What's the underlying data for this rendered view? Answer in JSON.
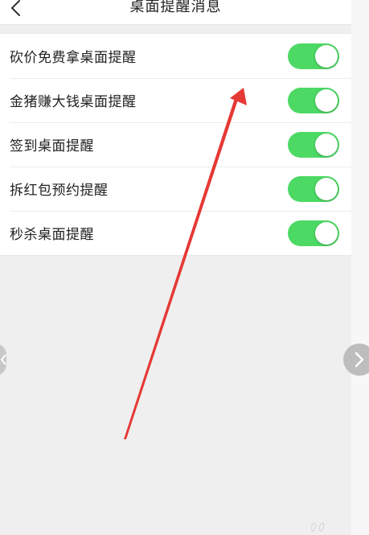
{
  "nav": {
    "title": "桌面提醒消息",
    "back_icon": "chevron-left-icon"
  },
  "settings": {
    "items": [
      {
        "label": "砍价免费拿桌面提醒",
        "enabled": true
      },
      {
        "label": "金猪赚大钱桌面提醒",
        "enabled": true
      },
      {
        "label": "签到桌面提醒",
        "enabled": true
      },
      {
        "label": "拆红包预约提醒",
        "enabled": true
      },
      {
        "label": "秒杀桌面提醒",
        "enabled": true
      }
    ]
  },
  "colors": {
    "toggle_on": "#4cd964",
    "annotation_arrow": "#e53935"
  },
  "icons": {
    "next": "chevron-right-icon",
    "prev": "chevron-left-icon"
  }
}
